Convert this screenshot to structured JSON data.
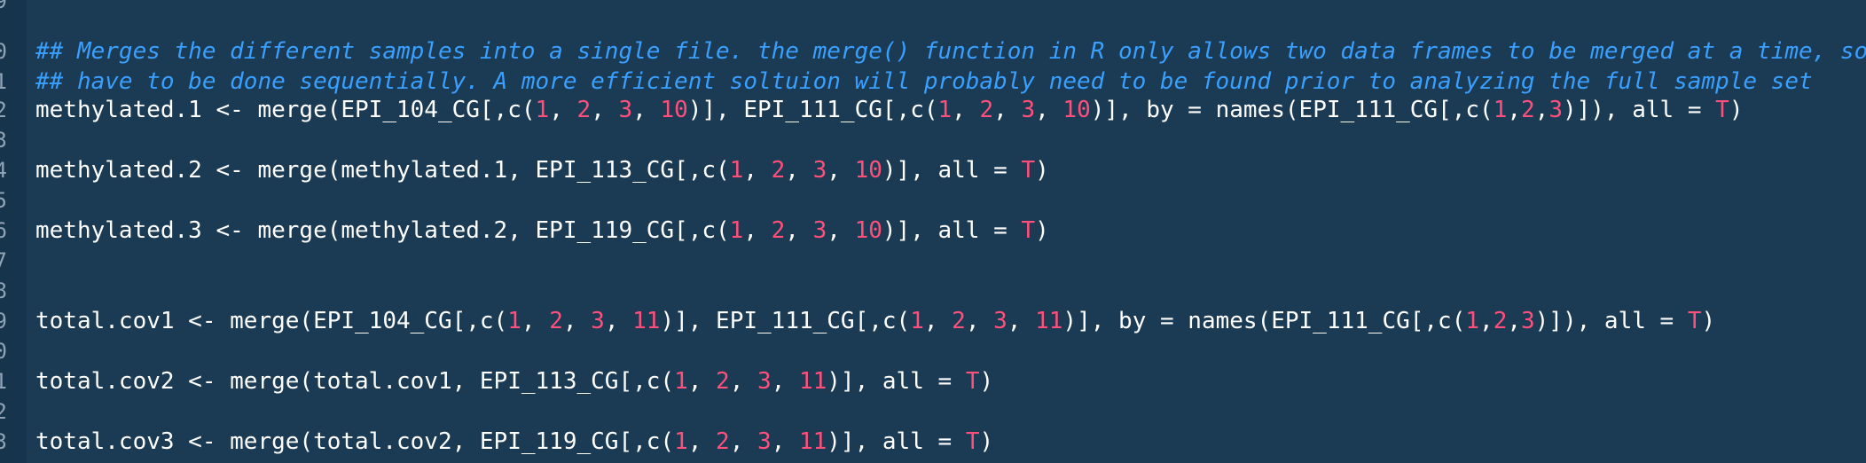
{
  "editor": {
    "line_numbers": [
      "9",
      "0",
      "1",
      "2",
      "3",
      "4",
      "5",
      "6",
      "7",
      "8",
      "9",
      "0",
      "1",
      "2",
      "3"
    ],
    "lines": [
      {
        "segments": []
      },
      {
        "segments": [
          {
            "t": "## Merges the different samples into a single file. the merge() function in R only allows two data frames to be merged at a time, so they",
            "c": "comment"
          }
        ]
      },
      {
        "segments": [
          {
            "t": "## have to be done sequentially. A more efficient soltuion will probably need to be found prior to analyzing the full sample set",
            "c": "comment"
          }
        ]
      },
      {
        "segments": [
          {
            "t": "methylated.1 <- merge(EPI_104_CG[,c(",
            "c": ""
          },
          {
            "t": "1",
            "c": "num"
          },
          {
            "t": ", ",
            "c": ""
          },
          {
            "t": "2",
            "c": "num"
          },
          {
            "t": ", ",
            "c": ""
          },
          {
            "t": "3",
            "c": "num"
          },
          {
            "t": ", ",
            "c": ""
          },
          {
            "t": "10",
            "c": "num"
          },
          {
            "t": ")], EPI_111_CG[,c(",
            "c": ""
          },
          {
            "t": "1",
            "c": "num"
          },
          {
            "t": ", ",
            "c": ""
          },
          {
            "t": "2",
            "c": "num"
          },
          {
            "t": ", ",
            "c": ""
          },
          {
            "t": "3",
            "c": "num"
          },
          {
            "t": ", ",
            "c": ""
          },
          {
            "t": "10",
            "c": "num"
          },
          {
            "t": ")], by = names(EPI_111_CG[,c(",
            "c": ""
          },
          {
            "t": "1",
            "c": "num"
          },
          {
            "t": ",",
            "c": ""
          },
          {
            "t": "2",
            "c": "num"
          },
          {
            "t": ",",
            "c": ""
          },
          {
            "t": "3",
            "c": "num"
          },
          {
            "t": ")]), all = ",
            "c": ""
          },
          {
            "t": "T",
            "c": "kw"
          },
          {
            "t": ")",
            "c": ""
          }
        ]
      },
      {
        "segments": []
      },
      {
        "segments": [
          {
            "t": "methylated.2 <- merge(methylated.1, EPI_113_CG[,c(",
            "c": ""
          },
          {
            "t": "1",
            "c": "num"
          },
          {
            "t": ", ",
            "c": ""
          },
          {
            "t": "2",
            "c": "num"
          },
          {
            "t": ", ",
            "c": ""
          },
          {
            "t": "3",
            "c": "num"
          },
          {
            "t": ", ",
            "c": ""
          },
          {
            "t": "10",
            "c": "num"
          },
          {
            "t": ")], all = ",
            "c": ""
          },
          {
            "t": "T",
            "c": "kw"
          },
          {
            "t": ")",
            "c": ""
          }
        ]
      },
      {
        "segments": []
      },
      {
        "segments": [
          {
            "t": "methylated.3 <- merge(methylated.2, EPI_119_CG[,c(",
            "c": ""
          },
          {
            "t": "1",
            "c": "num"
          },
          {
            "t": ", ",
            "c": ""
          },
          {
            "t": "2",
            "c": "num"
          },
          {
            "t": ", ",
            "c": ""
          },
          {
            "t": "3",
            "c": "num"
          },
          {
            "t": ", ",
            "c": ""
          },
          {
            "t": "10",
            "c": "num"
          },
          {
            "t": ")], all = ",
            "c": ""
          },
          {
            "t": "T",
            "c": "kw"
          },
          {
            "t": ")",
            "c": ""
          }
        ]
      },
      {
        "segments": []
      },
      {
        "segments": []
      },
      {
        "segments": [
          {
            "t": "total.cov1 <- merge(EPI_104_CG[,c(",
            "c": ""
          },
          {
            "t": "1",
            "c": "num"
          },
          {
            "t": ", ",
            "c": ""
          },
          {
            "t": "2",
            "c": "num"
          },
          {
            "t": ", ",
            "c": ""
          },
          {
            "t": "3",
            "c": "num"
          },
          {
            "t": ", ",
            "c": ""
          },
          {
            "t": "11",
            "c": "num"
          },
          {
            "t": ")], EPI_111_CG[,c(",
            "c": ""
          },
          {
            "t": "1",
            "c": "num"
          },
          {
            "t": ", ",
            "c": ""
          },
          {
            "t": "2",
            "c": "num"
          },
          {
            "t": ", ",
            "c": ""
          },
          {
            "t": "3",
            "c": "num"
          },
          {
            "t": ", ",
            "c": ""
          },
          {
            "t": "11",
            "c": "num"
          },
          {
            "t": ")], by = names(EPI_111_CG[,c(",
            "c": ""
          },
          {
            "t": "1",
            "c": "num"
          },
          {
            "t": ",",
            "c": ""
          },
          {
            "t": "2",
            "c": "num"
          },
          {
            "t": ",",
            "c": ""
          },
          {
            "t": "3",
            "c": "num"
          },
          {
            "t": ")]), all = ",
            "c": ""
          },
          {
            "t": "T",
            "c": "kw"
          },
          {
            "t": ")",
            "c": ""
          }
        ]
      },
      {
        "segments": []
      },
      {
        "segments": [
          {
            "t": "total.cov2 <- merge(total.cov1, EPI_113_CG[,c(",
            "c": ""
          },
          {
            "t": "1",
            "c": "num"
          },
          {
            "t": ", ",
            "c": ""
          },
          {
            "t": "2",
            "c": "num"
          },
          {
            "t": ", ",
            "c": ""
          },
          {
            "t": "3",
            "c": "num"
          },
          {
            "t": ", ",
            "c": ""
          },
          {
            "t": "11",
            "c": "num"
          },
          {
            "t": ")], all = ",
            "c": ""
          },
          {
            "t": "T",
            "c": "kw"
          },
          {
            "t": ")",
            "c": ""
          }
        ]
      },
      {
        "segments": []
      },
      {
        "segments": [
          {
            "t": "total.cov3 <- merge(total.cov2, EPI_119_CG[,c(",
            "c": ""
          },
          {
            "t": "1",
            "c": "num"
          },
          {
            "t": ", ",
            "c": ""
          },
          {
            "t": "2",
            "c": "num"
          },
          {
            "t": ", ",
            "c": ""
          },
          {
            "t": "3",
            "c": "num"
          },
          {
            "t": ", ",
            "c": ""
          },
          {
            "t": "11",
            "c": "num"
          },
          {
            "t": ")], all = ",
            "c": ""
          },
          {
            "t": "T",
            "c": "kw"
          },
          {
            "t": ")",
            "c": ""
          }
        ]
      }
    ]
  },
  "colors": {
    "background": "#1b3a53",
    "gutter": "#16344b",
    "default_text": "#ffffff",
    "comment": "#3aa0ff",
    "number": "#ff4f7b",
    "line_number": "#8fa3b5"
  }
}
